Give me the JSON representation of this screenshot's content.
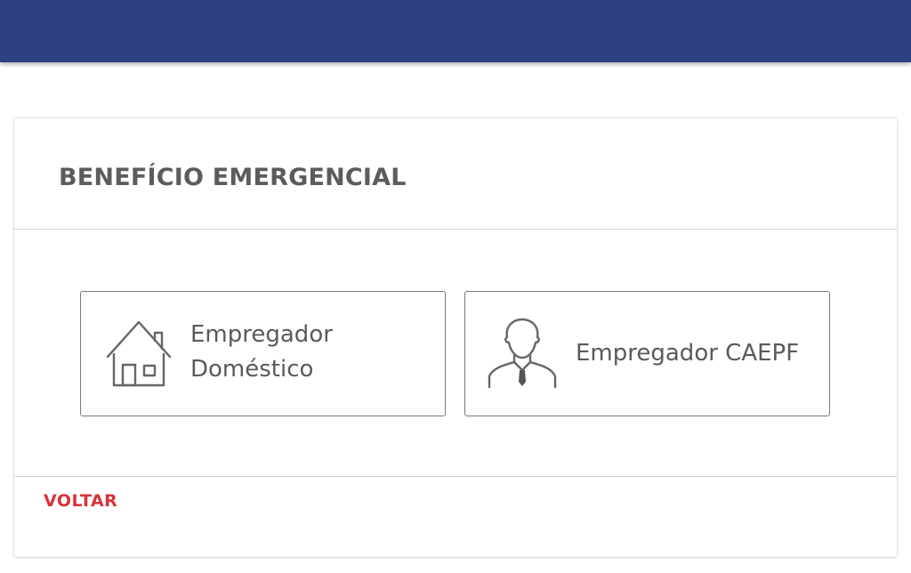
{
  "card": {
    "title": "BENEFÍCIO EMERGENCIAL",
    "options": [
      {
        "label": "Empregador Doméstico",
        "icon": "house-icon"
      },
      {
        "label": "Empregador CAEPF",
        "icon": "person-tie-icon"
      }
    ],
    "back_label": "VOLTAR"
  },
  "colors": {
    "topbar": "#2d4182",
    "back_link": "#d8323a",
    "text": "#5a5a5a"
  }
}
